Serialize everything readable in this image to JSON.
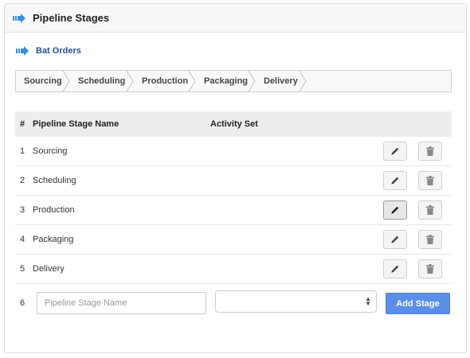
{
  "panel": {
    "title": "Pipeline Stages",
    "title_icon": "arrow-right-icon"
  },
  "subhead": {
    "title": "Bat Orders",
    "icon": "arrow-right-icon"
  },
  "steps": [
    "Sourcing",
    "Scheduling",
    "Production",
    "Packaging",
    "Delivery"
  ],
  "table": {
    "headers": {
      "num": "#",
      "name": "Pipeline Stage Name",
      "activity": "Activity Set"
    },
    "rows": [
      {
        "num": "1",
        "name": "Sourcing"
      },
      {
        "num": "2",
        "name": "Scheduling"
      },
      {
        "num": "3",
        "name": "Production"
      },
      {
        "num": "4",
        "name": "Packaging"
      },
      {
        "num": "5",
        "name": "Delivery"
      }
    ],
    "row_actions": [
      "pencil-icon",
      "trash-icon"
    ]
  },
  "add_row": {
    "num": "6",
    "name_placeholder": "Pipeline Stage Name",
    "name_value": "",
    "activity_selected": "",
    "button_label": "Add Stage"
  },
  "colors": {
    "accent": "#5b8ee6",
    "link": "#2b4f9a",
    "icon_blue": "#3b8fd9"
  }
}
